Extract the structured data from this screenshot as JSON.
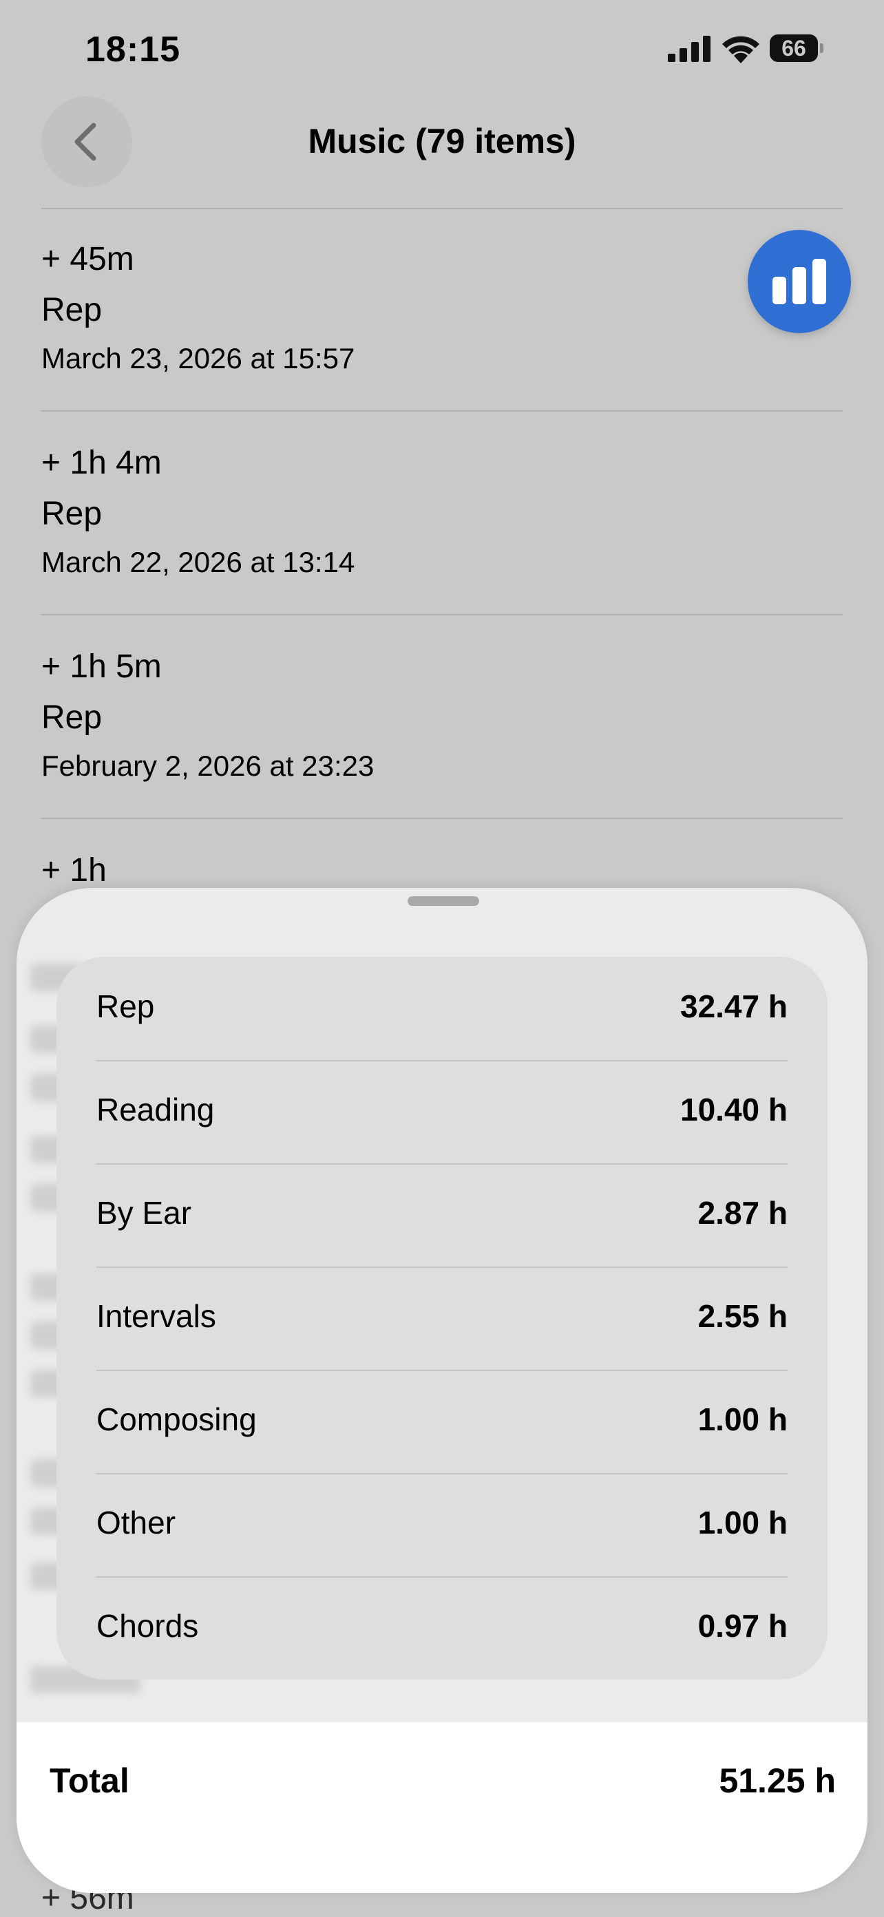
{
  "status_bar": {
    "time": "18:15",
    "battery_level": "66"
  },
  "nav": {
    "title": "Music (79 items)"
  },
  "entries": [
    {
      "amount": "+ 45m",
      "category": "Rep",
      "date": "March 23, 2026 at 15:57"
    },
    {
      "amount": "+ 1h 4m",
      "category": "Rep",
      "date": "March 22, 2026 at 13:14"
    },
    {
      "amount": "+ 1h 5m",
      "category": "Rep",
      "date": "February 2, 2026 at 23:23"
    },
    {
      "amount": "+ 1h"
    }
  ],
  "peek_bottom": "+ 56m",
  "summary": {
    "rows": [
      {
        "label": "Rep",
        "value": "32.47 h"
      },
      {
        "label": "Reading",
        "value": "10.40 h"
      },
      {
        "label": "By Ear",
        "value": "2.87 h"
      },
      {
        "label": "Intervals",
        "value": "2.55 h"
      },
      {
        "label": "Composing",
        "value": "1.00 h"
      },
      {
        "label": "Other",
        "value": "1.00 h"
      },
      {
        "label": "Chords",
        "value": "0.97 h"
      }
    ],
    "total_label": "Total",
    "total_value": "51.25 h"
  },
  "icons": {
    "back": "chevron-left-icon",
    "stats": "bar-chart-icon",
    "signal": "cellular-signal-icon",
    "wifi": "wifi-icon",
    "battery": "battery-icon"
  },
  "colors": {
    "accent": "#2f6ed3",
    "background": "#c9c9c9",
    "sheet": "#ebebeb"
  }
}
